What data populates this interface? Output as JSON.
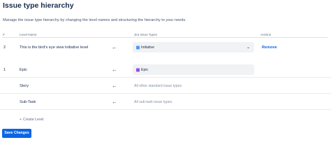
{
  "page": {
    "title": "Issue type hierarchy",
    "description": "Manage the issue type hierarchy by changing the level names and structuring the hierarchy to your needs."
  },
  "table": {
    "headers": {
      "number": "#",
      "level_name": "Level Name",
      "jira_issue_types": "Jira Issue Types",
      "actions": "Actions"
    },
    "rows": [
      {
        "number": "2",
        "level_name": "This is the bird's eye view initiative level",
        "type": "Initiative",
        "type_icon": "initiative-icon",
        "action": "Remove"
      },
      {
        "number": "1",
        "level_name": "Epic",
        "type": "Epic",
        "type_icon": "epic-icon"
      },
      {
        "number": "",
        "level_name": "Story",
        "type_text": "All other standard issue types"
      },
      {
        "number": "",
        "level_name": "Sub-Task",
        "type_text": "All sub-task issue types"
      }
    ],
    "arrow_icon": "arrow-left-icon",
    "dropdown_icon": "chevron-down-icon"
  },
  "create_level": {
    "icon": "plus-icon",
    "label": "Create Level"
  },
  "save_button": {
    "label": "Save Changes"
  },
  "colors": {
    "primary": "#0c66e4",
    "initiative_icon": "#4c9aff",
    "epic_icon": "#904ee2"
  }
}
